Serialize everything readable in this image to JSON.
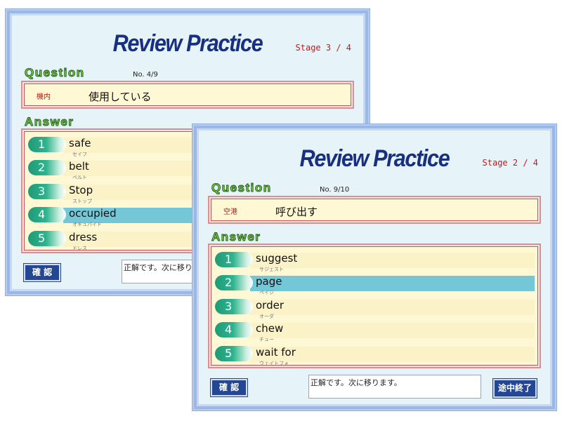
{
  "back_window": {
    "title": "Review Practice",
    "stage": "Stage 3 / 4",
    "question_heading": "Question",
    "question_number": "No. 4/9",
    "hint": "機内",
    "question_text": "使用している",
    "answer_heading": "Answer",
    "answers": [
      {
        "number": "1",
        "word": "safe",
        "reading": "セイフ"
      },
      {
        "number": "2",
        "word": "belt",
        "reading": "ベルト"
      },
      {
        "number": "3",
        "word": "Stop",
        "reading": "ストップ"
      },
      {
        "number": "4",
        "word": "occupied",
        "reading": "オキュパイド"
      },
      {
        "number": "5",
        "word": "dress",
        "reading": "ドレス"
      }
    ],
    "selected_answer": 4,
    "confirm_label": "確 認",
    "message": "正解です。次に移り"
  },
  "front_window": {
    "title": "Review Practice",
    "stage": "Stage 2 / 4",
    "question_heading": "Question",
    "question_number": "No. 9/10",
    "hint": "空港",
    "question_text": "呼び出す",
    "answer_heading": "Answer",
    "answers": [
      {
        "number": "1",
        "word": "suggest",
        "reading": "サジェスト"
      },
      {
        "number": "2",
        "word": "page",
        "reading": "ペイジ"
      },
      {
        "number": "3",
        "word": "order",
        "reading": "オーダ"
      },
      {
        "number": "4",
        "word": "chew",
        "reading": "チュー"
      },
      {
        "number": "5",
        "word": "wait for",
        "reading": "ウェイトフォ"
      }
    ],
    "selected_answer": 2,
    "confirm_label": "確 認",
    "message": "正解です。次に移ります。",
    "quit_label": "途中終了"
  },
  "colors": {
    "title": "#18307f",
    "stage": "#d21515",
    "heading_fill": "#7fd84e",
    "selected_row": "#74c7d6",
    "pill": "#2eb48e",
    "button": "#234793",
    "panel": "#fff8d4"
  }
}
